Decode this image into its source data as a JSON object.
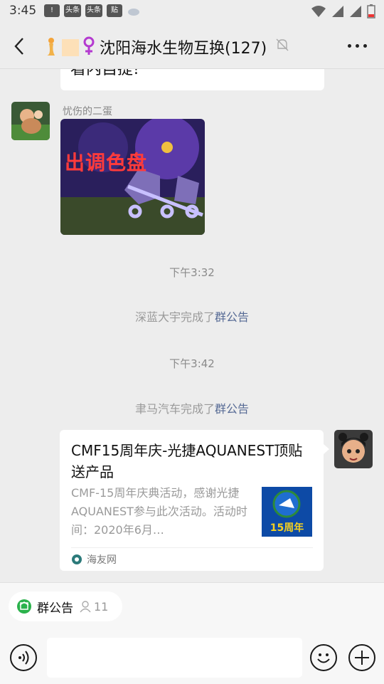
{
  "status_bar": {
    "time": "3:45",
    "notifications": [
      "!",
      "头条",
      "头条",
      "贴"
    ]
  },
  "header": {
    "title": "沈阳海水生物互换(127)"
  },
  "chat": {
    "prev_message_text": "看内自提!",
    "messages": [
      {
        "sender": "忧伤的二蛋",
        "image_caption": "出调色盘"
      }
    ],
    "time_1": "下午3:32",
    "sys_1_user": "深蓝大宇完成了",
    "sys_1_link": "群公告",
    "time_2": "下午3:42",
    "sys_2_user": "聿马汽车完成了",
    "sys_2_link": "群公告",
    "card": {
      "title": "CMF15周年庆-光捷AQUANEST顶贴送产品",
      "description": "CMF-15周年庆典活动，感谢光捷AQUANEST参与此次活动。活动时间：2020年6月…",
      "thumb_text": "15周年",
      "source": "海友网"
    }
  },
  "bottom": {
    "notice_label": "群公告",
    "notice_count": "11",
    "input_placeholder": ""
  },
  "colors": {
    "background": "#ededed",
    "link": "#576b95",
    "accent_green": "#2bb24c"
  }
}
